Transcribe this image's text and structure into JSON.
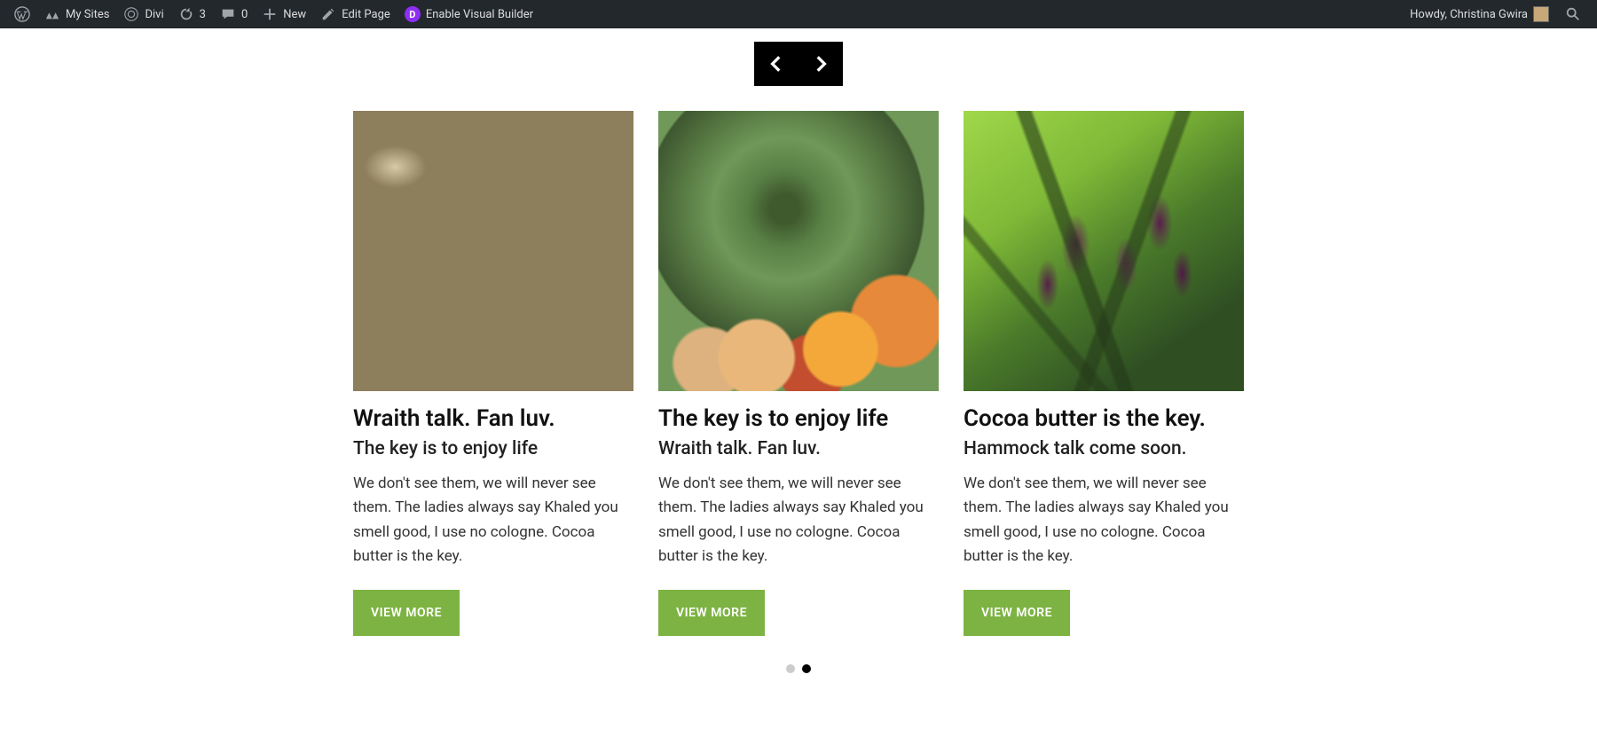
{
  "adminbar": {
    "mysites": "My Sites",
    "site_name": "Divi",
    "updates": "3",
    "comments": "0",
    "new": "New",
    "edit_page": "Edit Page",
    "visual_builder": "Enable Visual Builder",
    "howdy_prefix": "Howdy, ",
    "user_name": "Christina Gwira"
  },
  "cards": [
    {
      "title": "Wraith talk. Fan luv.",
      "subtitle": "The key is to enjoy life",
      "desc": "We don't see them, we will never see them. The ladies always say Khaled you smell good, I use no cologne. Cocoa butter is the key.",
      "cta": "VIEW MORE",
      "img": "potatoes"
    },
    {
      "title": "The key is to enjoy life",
      "subtitle": "Wraith talk. Fan luv.",
      "desc": "We don't see them, we will never see them. The ladies always say Khaled you smell good, I use no cologne. Cocoa butter is the key.",
      "cta": "VIEW MORE",
      "img": "artichoke"
    },
    {
      "title": "Cocoa butter is the key.",
      "subtitle": "Hammock talk come soon.",
      "desc": "We don't see them, we will never see them. The ladies always say Khaled you smell good, I use no cologne. Cocoa butter is the key.",
      "cta": "VIEW MORE",
      "img": "peppers"
    }
  ],
  "pagination": {
    "count": 2,
    "active_index": 1
  }
}
